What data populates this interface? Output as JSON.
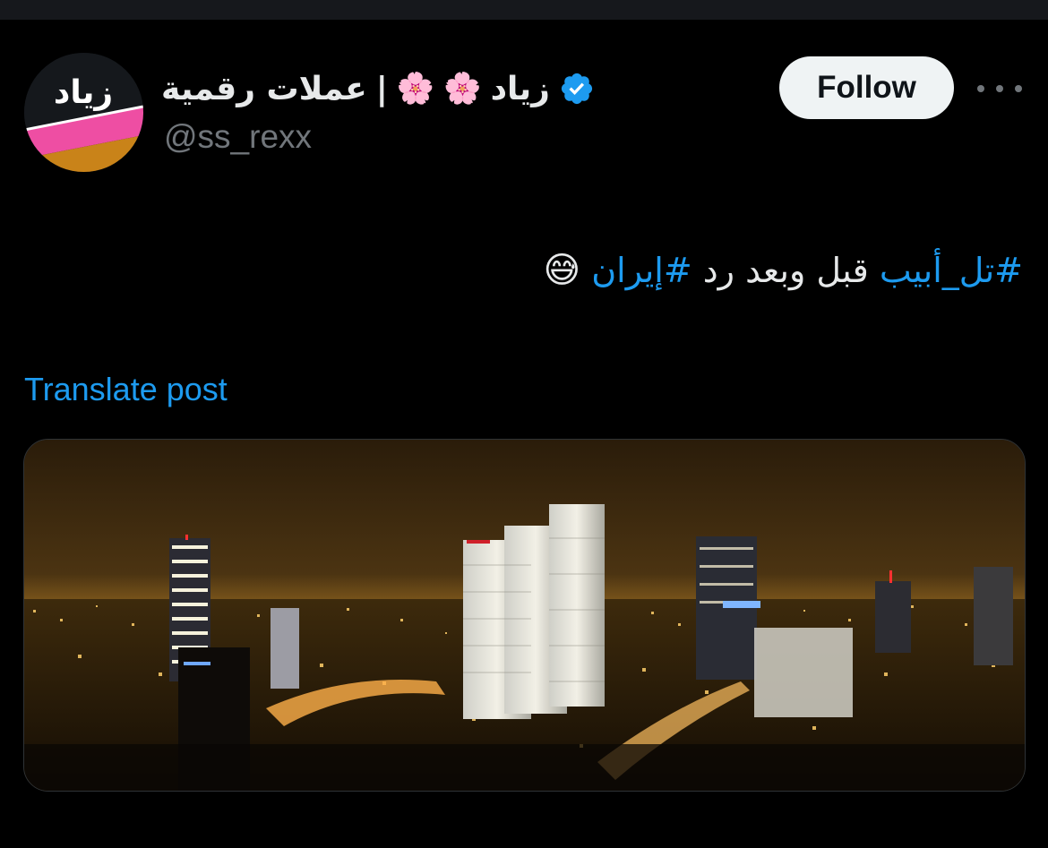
{
  "post": {
    "author": {
      "display_name_text": "زياد",
      "name_emoji_1": "🌸",
      "name_emoji_2": "🌸",
      "name_separator": "|",
      "name_suffix": "عملات رقمية",
      "handle": "@ss_rexx",
      "verified": true,
      "avatar_text": "زياد"
    },
    "follow_label": "Follow",
    "text": {
      "hashtag_1": "#تل_أبيب",
      "middle": " قبل وبعد رد ",
      "hashtag_2": "#إيران",
      "emoji": "😅"
    },
    "translate_label": "Translate post"
  },
  "icons": {
    "verified": "verified-badge-icon",
    "more": "more-options-icon"
  },
  "colors": {
    "background": "#000000",
    "text_primary": "#e7e9ea",
    "text_secondary": "#71767b",
    "accent": "#1d9bf0",
    "follow_bg": "#eff3f4",
    "follow_text": "#0f1419"
  }
}
